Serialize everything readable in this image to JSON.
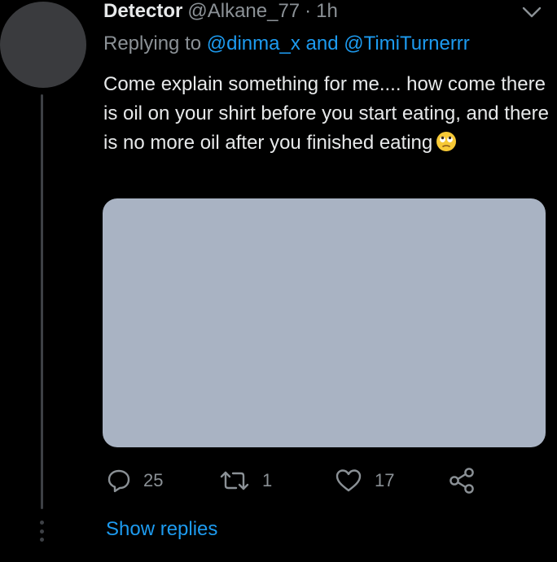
{
  "tweet": {
    "author_name": "Detector",
    "author_handle": "@Alkane_77",
    "separator": "·",
    "timestamp": "1h",
    "reply_prefix": "Replying to",
    "reply_mention_1": "@dinma_x",
    "reply_conjunction": "and",
    "reply_mention_2": "@TimiTurnerrr",
    "text": "Come explain something for me.... how come there is oil on your shirt before you start eating, and there is no more oil after you finished eating",
    "emoji": "face-with-rolling-eyes"
  },
  "actions": {
    "reply_count": "25",
    "retweet_count": "1",
    "like_count": "17"
  },
  "thread": {
    "show_replies_label": "Show replies"
  },
  "colors": {
    "background": "#000000",
    "link": "#1d9bf0",
    "secondary_text": "#8b9196",
    "primary_text": "#e7e9ea",
    "media_placeholder": "#a9b3c3"
  },
  "icons": {
    "more": "chevron-down-icon",
    "reply": "reply-icon",
    "retweet": "retweet-icon",
    "like": "heart-icon",
    "share": "share-icon"
  }
}
